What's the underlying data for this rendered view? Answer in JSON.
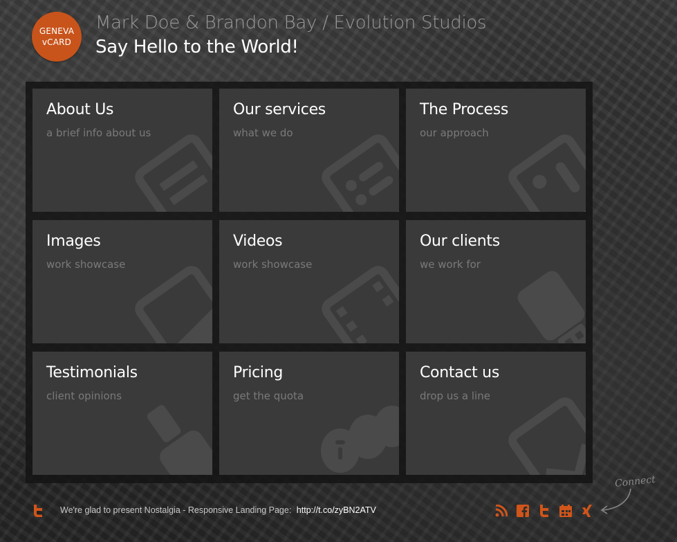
{
  "header": {
    "logo_line1": "GENEVA",
    "logo_line2": "vCARD",
    "title": "Mark Doe & Brandon Bay / Evolution Studios",
    "subtitle": "Say Hello to the World!"
  },
  "tiles": [
    {
      "title": "About Us",
      "subtitle": "a brief info about us",
      "icon": "document-icon"
    },
    {
      "title": "Our services",
      "subtitle": "what we do",
      "icon": "list-icon"
    },
    {
      "title": "The Process",
      "subtitle": "our approach",
      "icon": "process-icon"
    },
    {
      "title": "Images",
      "subtitle": "work showcase",
      "icon": "image-icon"
    },
    {
      "title": "Videos",
      "subtitle": "work showcase",
      "icon": "film-icon"
    },
    {
      "title": "Our clients",
      "subtitle": "we work for",
      "icon": "usb-icon"
    },
    {
      "title": "Testimonials",
      "subtitle": "client opinions",
      "icon": "brush-icon"
    },
    {
      "title": "Pricing",
      "subtitle": "get the quota",
      "icon": "coins-icon"
    },
    {
      "title": "Contact us",
      "subtitle": "drop us a line",
      "icon": "mail-icon"
    }
  ],
  "footer": {
    "text": "We're glad to present Nostalgia - Responsive Landing Page:",
    "link": "http://t.co/zyBN2ATV",
    "connect_label": "Connect",
    "social": [
      "rss-icon",
      "facebook-icon",
      "twitter-icon",
      "calendar-icon",
      "xing-icon"
    ]
  },
  "colors": {
    "accent": "#c8541b",
    "tile_bg": "#3a3a3a",
    "grid_bg": "#141414"
  }
}
